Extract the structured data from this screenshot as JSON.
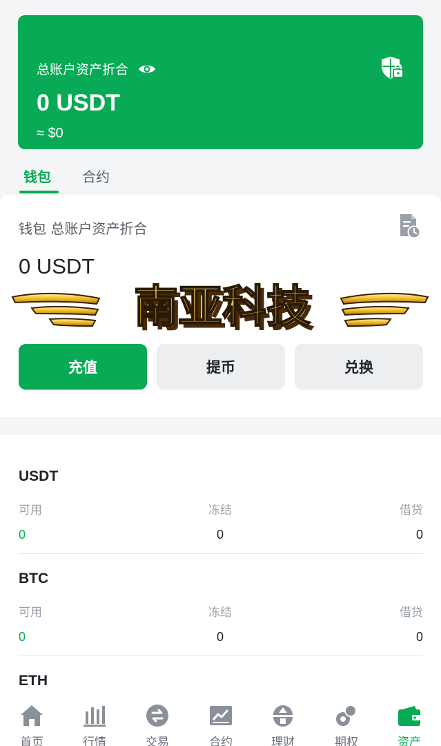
{
  "hero": {
    "label": "总账户资产折合",
    "amount": "0 USDT",
    "approx": "≈ $0"
  },
  "tabs": [
    {
      "label": "钱包",
      "active": true
    },
    {
      "label": "合约",
      "active": false
    }
  ],
  "wallet": {
    "title": "钱包 总账户资产折合",
    "balance": "0 USDT",
    "banner_text": "南亚科技",
    "buttons": {
      "deposit": "充值",
      "withdraw": "提币",
      "exchange": "兑换"
    }
  },
  "assets": [
    {
      "name": "USDT",
      "available_label": "可用",
      "frozen_label": "冻结",
      "loan_label": "借贷",
      "available": "0",
      "frozen": "0",
      "loan": "0"
    },
    {
      "name": "BTC",
      "available_label": "可用",
      "frozen_label": "冻结",
      "loan_label": "借贷",
      "available": "0",
      "frozen": "0",
      "loan": "0"
    },
    {
      "name": "ETH"
    }
  ],
  "nav": [
    {
      "label": "首页",
      "icon": "home-icon"
    },
    {
      "label": "行情",
      "icon": "market-icon"
    },
    {
      "label": "交易",
      "icon": "trade-icon"
    },
    {
      "label": "合约",
      "icon": "contract-icon"
    },
    {
      "label": "理财",
      "icon": "finance-icon"
    },
    {
      "label": "期权",
      "icon": "options-icon"
    },
    {
      "label": "资产",
      "icon": "wallet-icon",
      "active": true
    }
  ],
  "colors": {
    "accent": "#08aa55",
    "background": "#f3f5f7",
    "secondary_button": "#eceef0"
  }
}
